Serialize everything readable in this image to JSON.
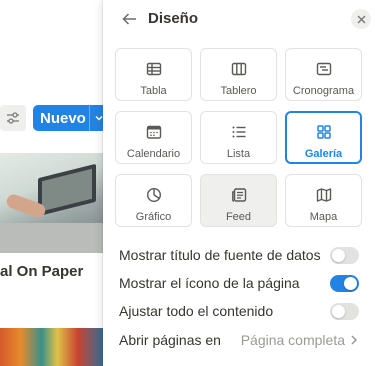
{
  "background": {
    "new_button_label": "Nuevo",
    "card_title": "al On Paper"
  },
  "panel": {
    "title": "Diseño",
    "layouts": [
      {
        "label": "Tabla",
        "icon": "table-icon"
      },
      {
        "label": "Tablero",
        "icon": "board-icon"
      },
      {
        "label": "Cronograma",
        "icon": "timeline-icon"
      },
      {
        "label": "Calendario",
        "icon": "calendar-icon"
      },
      {
        "label": "Lista",
        "icon": "list-icon"
      },
      {
        "label": "Galería",
        "icon": "gallery-icon",
        "selected": true
      },
      {
        "label": "Gráfico",
        "icon": "chart-icon"
      },
      {
        "label": "Feed",
        "icon": "feed-icon"
      },
      {
        "label": "Mapa",
        "icon": "map-icon"
      }
    ],
    "settings": [
      {
        "label": "Mostrar título de fuente de datos",
        "type": "toggle",
        "on": false
      },
      {
        "label": "Mostrar el ícono de la página",
        "type": "toggle",
        "on": true
      },
      {
        "label": "Ajustar todo el contenido",
        "type": "toggle",
        "on": false
      },
      {
        "label": "Abrir páginas en",
        "type": "select",
        "value": "Página completa"
      }
    ]
  },
  "colors": {
    "accent": "#2383e2",
    "text": "#37352f",
    "muted": "#9b9a97"
  }
}
